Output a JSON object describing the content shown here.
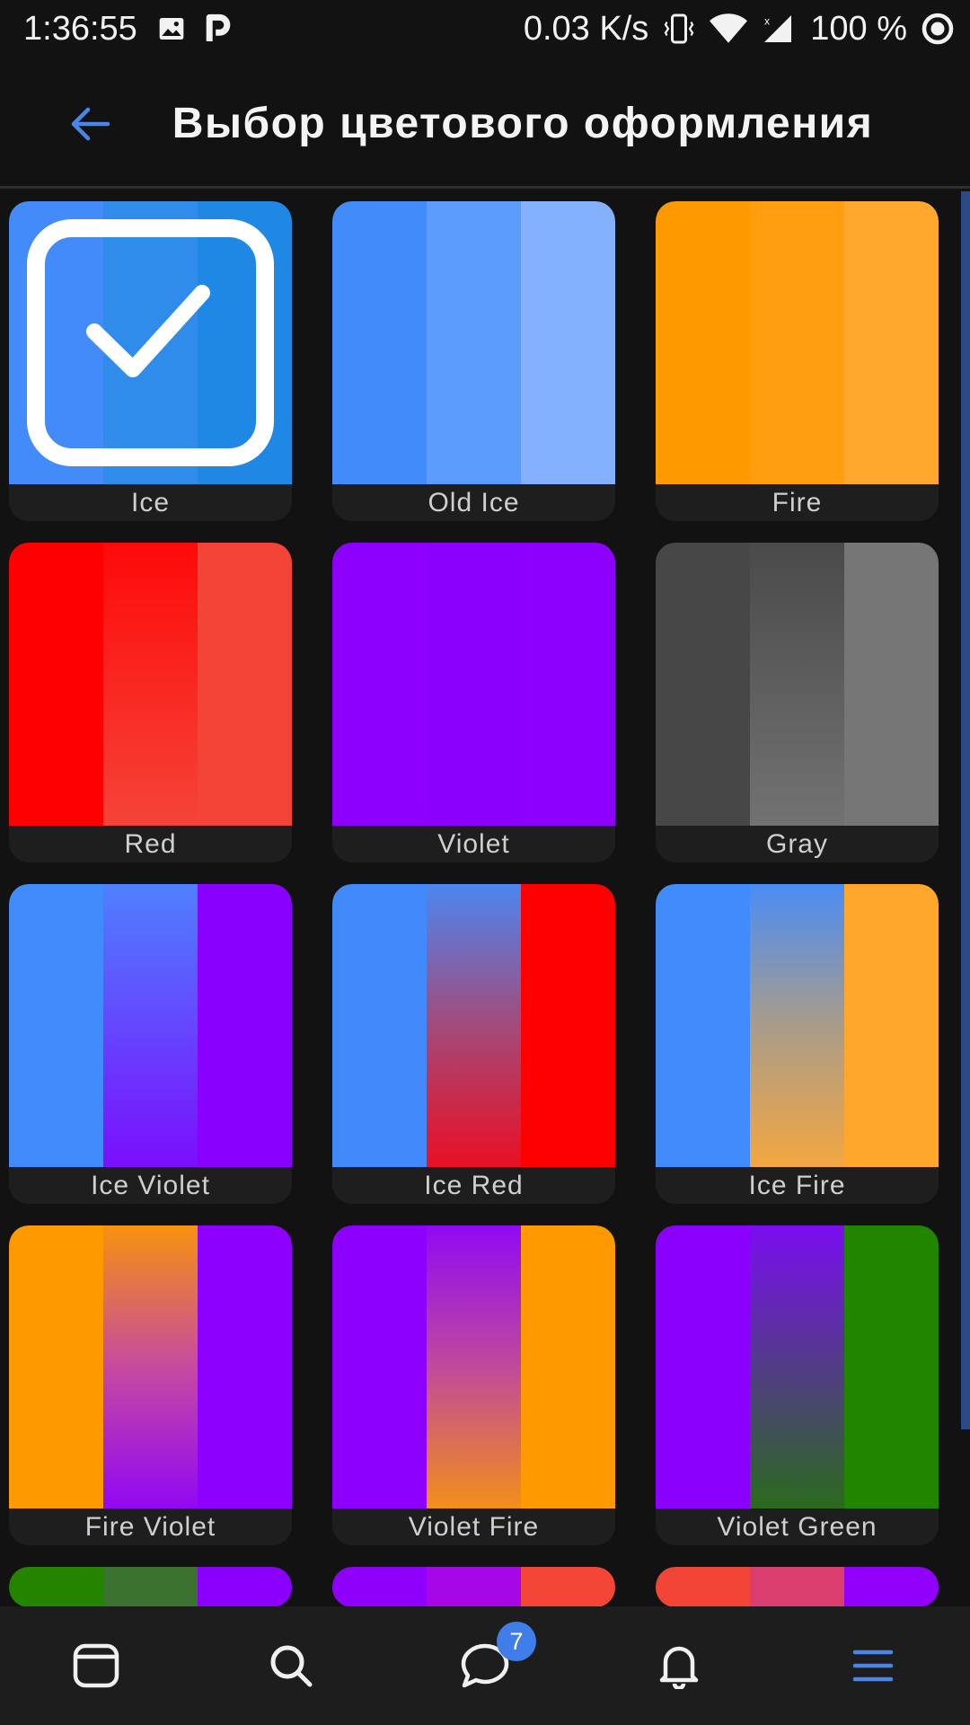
{
  "status_bar": {
    "time": "1:36:55",
    "net_speed": "0.03 K/s",
    "battery": "100 %",
    "icons": [
      "image-icon",
      "p-app-icon",
      "vibrate-icon",
      "wifi-icon",
      "signal-icon",
      "circle-dot-icon"
    ]
  },
  "header": {
    "title": "Выбор цветового оформления",
    "back_icon": "arrow-left-icon",
    "accent": "#4a86e8"
  },
  "themes": [
    {
      "name": "Ice",
      "colors": [
        "#428bf8",
        "#2f8cea",
        "#1f88e5"
      ],
      "selected": true
    },
    {
      "name": "Old Ice",
      "colors": [
        "#428bfb",
        "#5c9cfd",
        "#84b1fd"
      ]
    },
    {
      "name": "Fire",
      "colors": [
        "#ff9900",
        "#ff9f10",
        "#ffa82d"
      ]
    },
    {
      "name": "Red",
      "colors": [
        "#fe0000",
        "#fc1c1c",
        "#f44438"
      ]
    },
    {
      "name": "Violet",
      "colors": [
        "#8d00fd",
        "#8b00fb",
        "#8c00fc"
      ]
    },
    {
      "name": "Gray",
      "colors": [
        "#474747",
        "#5c5c5c",
        "#767676"
      ]
    },
    {
      "name": "Ice Violet",
      "colors": [
        "#428bfd",
        "#6253fb",
        "#8900ff"
      ]
    },
    {
      "name": "Ice Red",
      "colors": [
        "#428afc",
        "#a33b62",
        "#ff0000"
      ]
    },
    {
      "name": "Ice Fire",
      "colors": [
        "#428bfd",
        "#b3a07d",
        "#ffa62d"
      ]
    },
    {
      "name": "Fire Violet",
      "colors": [
        "#ff9900",
        "#c24aa0",
        "#8d00fd"
      ]
    },
    {
      "name": "Violet Fire",
      "colors": [
        "#8d00fe",
        "#c0469b",
        "#ff9900"
      ]
    },
    {
      "name": "Violet Green",
      "colors": [
        "#8b00fd",
        "#4d3b8b",
        "#218500"
      ]
    },
    {
      "name": "",
      "colors": [
        "#248400",
        "#3c7230",
        "#8b00fd"
      ]
    },
    {
      "name": "",
      "colors": [
        "#8f00fb",
        "#a507e6",
        "#f44636"
      ]
    },
    {
      "name": "",
      "colors": [
        "#f34438",
        "#da3e6e",
        "#9100fb"
      ]
    }
  ],
  "bottom_nav": {
    "items": [
      {
        "icon": "tab-card-icon",
        "active": false
      },
      {
        "icon": "search-icon",
        "active": false
      },
      {
        "icon": "chat-bubble-icon",
        "active": false
      },
      {
        "icon": "bell-icon",
        "active": false
      },
      {
        "icon": "hamburger-menu-icon",
        "active": true
      }
    ],
    "messages_badge": "7",
    "active_color": "#4a86e8",
    "inactive_color": "#f0f0f0"
  }
}
